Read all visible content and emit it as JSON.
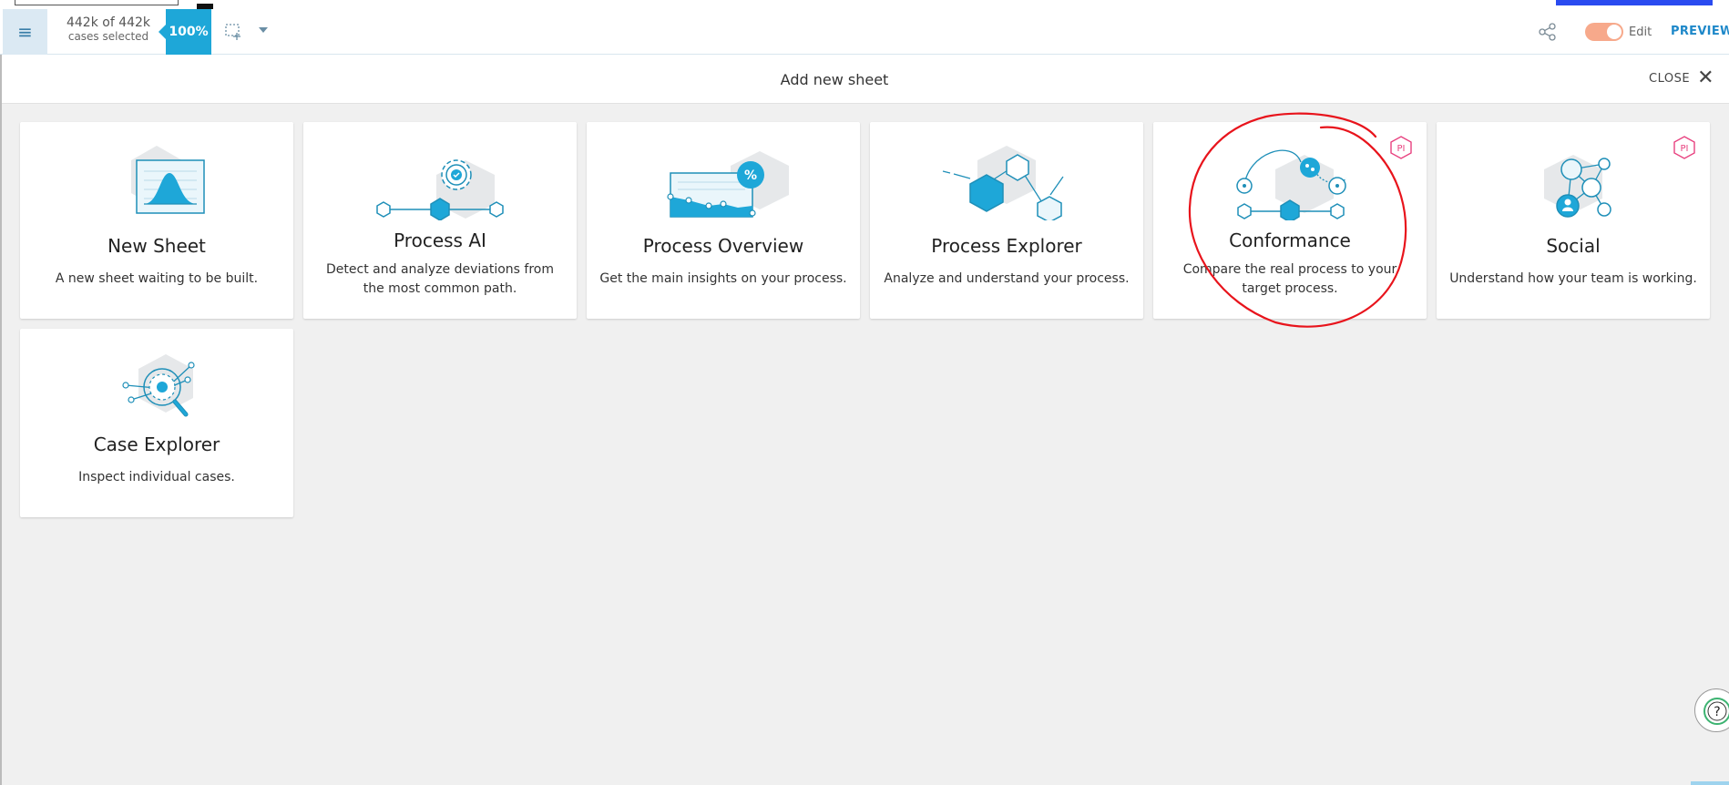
{
  "toolbar": {
    "menu_icon": "hamburger-icon",
    "cases_count": "442k of 442k",
    "cases_label": "cases selected",
    "percent": "100%",
    "select_tool_icon": "selection-add-icon",
    "share_icon": "share-icon",
    "edit_label": "Edit",
    "edit_toggle_on": true,
    "preview_label": "PREVIEW"
  },
  "dialog": {
    "title": "Add new sheet",
    "close_label": "CLOSE"
  },
  "cards": [
    {
      "title": "New Sheet",
      "description": "A new sheet waiting to be built.",
      "badge": ""
    },
    {
      "title": "Process AI",
      "description": "Detect and analyze deviations from the most common path.",
      "badge": ""
    },
    {
      "title": "Process Overview",
      "description": "Get the main insights on your process.",
      "badge": ""
    },
    {
      "title": "Process Explorer",
      "description": "Analyze and understand your process.",
      "badge": ""
    },
    {
      "title": "Conformance",
      "description": "Compare the real process to your target process.",
      "badge": "PI"
    },
    {
      "title": "Social",
      "description": "Understand how your team is working.",
      "badge": "PI"
    },
    {
      "title": "Case Explorer",
      "description": "Inspect individual cases.",
      "badge": ""
    }
  ],
  "colors": {
    "accent": "#1ea7d8",
    "preview": "#1e88c9",
    "toggle": "#f7a98b",
    "badge": "#e8417f",
    "annotation": "#e8141c"
  }
}
